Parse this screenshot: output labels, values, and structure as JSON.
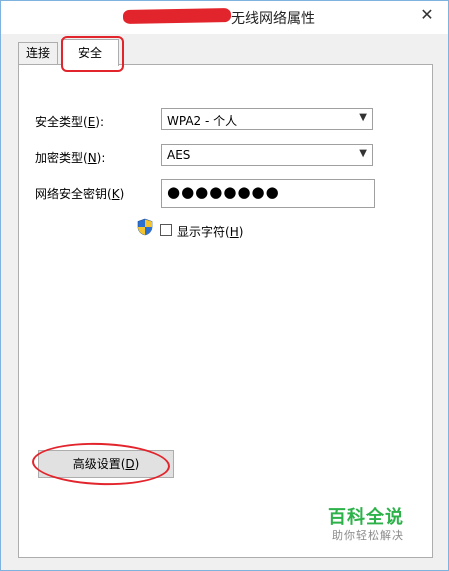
{
  "window": {
    "title": "无线网络属性",
    "close_glyph": "✕"
  },
  "tabs": [
    {
      "label": "连接",
      "selected": false
    },
    {
      "label": "安全",
      "selected": true
    }
  ],
  "security": {
    "security_type": {
      "label_prefix": "安全类型(",
      "label_key": "E",
      "label_suffix": "):",
      "value": "WPA2 - 个人"
    },
    "encryption_type": {
      "label_prefix": "加密类型(",
      "label_key": "N",
      "label_suffix": "):",
      "value": "AES"
    },
    "network_key": {
      "label_prefix": "网络安全密钥(",
      "label_key": "K",
      "label_suffix": ")",
      "value": "●●●●●●●●"
    },
    "show_characters": {
      "label_prefix": "显示字符(",
      "label_key": "H",
      "label_suffix": ")",
      "checked": false
    },
    "advanced_button": {
      "label_prefix": "高级设置(",
      "label_key": "D",
      "label_suffix": ")"
    }
  },
  "watermark": {
    "brand": "百科全说",
    "tagline": "助你轻松解决"
  },
  "colors": {
    "annotation_red": "#e2252c",
    "watermark_green": "#2db24a",
    "window_border": "#7fb2dd"
  }
}
